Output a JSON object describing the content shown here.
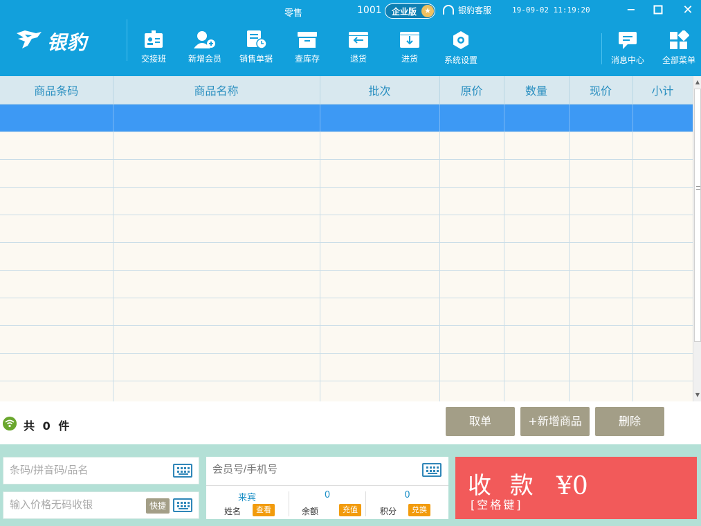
{
  "titlebar": {
    "title": "零售",
    "shop_id": "1001",
    "edition": "企业版",
    "support": "银豹客服",
    "datetime": "19-09-02 11:19:20"
  },
  "logo": {
    "text": "银豹"
  },
  "toolbar": {
    "items": [
      {
        "label": "交接班",
        "icon": "id-card-icon"
      },
      {
        "label": "新增会员",
        "icon": "add-member-icon"
      },
      {
        "label": "销售单据",
        "icon": "sales-doc-icon"
      },
      {
        "label": "查库存",
        "icon": "inventory-box-icon"
      },
      {
        "label": "退货",
        "icon": "return-icon"
      },
      {
        "label": "进货",
        "icon": "stock-in-icon"
      },
      {
        "label": "系统设置",
        "icon": "settings-gear-icon"
      },
      {
        "label": "消息中心",
        "icon": "message-icon"
      },
      {
        "label": "全部菜单",
        "icon": "menu-grid-icon"
      }
    ]
  },
  "table": {
    "columns": [
      "商品条码",
      "商品名称",
      "批次",
      "原价",
      "数量",
      "现价",
      "小计"
    ]
  },
  "summary": {
    "prefix": "共",
    "count": "0",
    "suffix": "件"
  },
  "actions": {
    "cancel_order": "取单",
    "add_product": "+新增商品",
    "delete": "删除"
  },
  "inputs": {
    "barcode_placeholder": "条码/拼音码/品名",
    "price_placeholder": "输入价格无码收银",
    "quick_label": "快捷",
    "member_placeholder": "会员号/手机号"
  },
  "member": {
    "name_value": "来宾",
    "name_label": "姓名",
    "view_btn": "查看",
    "balance_value": "0",
    "balance_label": "余额",
    "recharge_btn": "充值",
    "points_value": "0",
    "points_label": "积分",
    "exchange_btn": "兑换"
  },
  "payment": {
    "label": "收 款",
    "hint": "[空格键]",
    "amount": "¥0"
  },
  "colors": {
    "header": "#12a0dc",
    "selected_row": "#3d99f4",
    "pay": "#f25a5a",
    "bottom": "#b3e0d6"
  }
}
